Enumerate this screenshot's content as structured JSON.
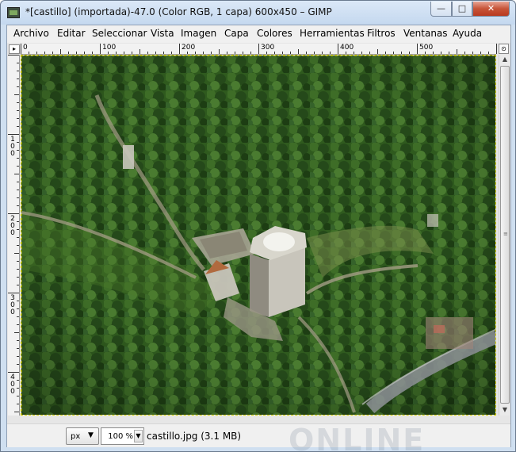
{
  "window": {
    "title": "*[castillo] (importada)-47.0 (Color RGB, 1 capa) 600x450 – GIMP",
    "minimize_glyph": "—",
    "maximize_glyph": "□",
    "close_glyph": "✕"
  },
  "menu": [
    "Archivo",
    "Editar",
    "Seleccionar",
    "Vista",
    "Imagen",
    "Capa",
    "Colores",
    "Herramientas",
    "Filtros",
    "Ventanas",
    "Ayuda"
  ],
  "rulers": {
    "horizontal_labels": [
      "0",
      "100",
      "200",
      "300",
      "400",
      "500"
    ],
    "vertical_labels": [
      "100",
      "200",
      "300",
      "400"
    ]
  },
  "canvas": {
    "colors": {
      "forest_dark": "#1f3f14",
      "forest": "#2f5a1e",
      "forest_light": "#4d7a2c",
      "clearing": "#7e8f4e",
      "tower": "#c8c5bb",
      "tower_shadow": "#8f8b80",
      "path": "#a49d86"
    }
  },
  "statusbar": {
    "unit": "px",
    "zoom": "100 %",
    "file_info": "castillo.jpg (3.1 MB)",
    "watermark": "ONLINE"
  },
  "icons": {
    "menu_arrow": "▸",
    "dropdown_arrow": "▼",
    "scroll_up": "▲",
    "scroll_down": "▼",
    "scroll_left": "◀",
    "scroll_right": "▶",
    "navigate": "✥"
  }
}
